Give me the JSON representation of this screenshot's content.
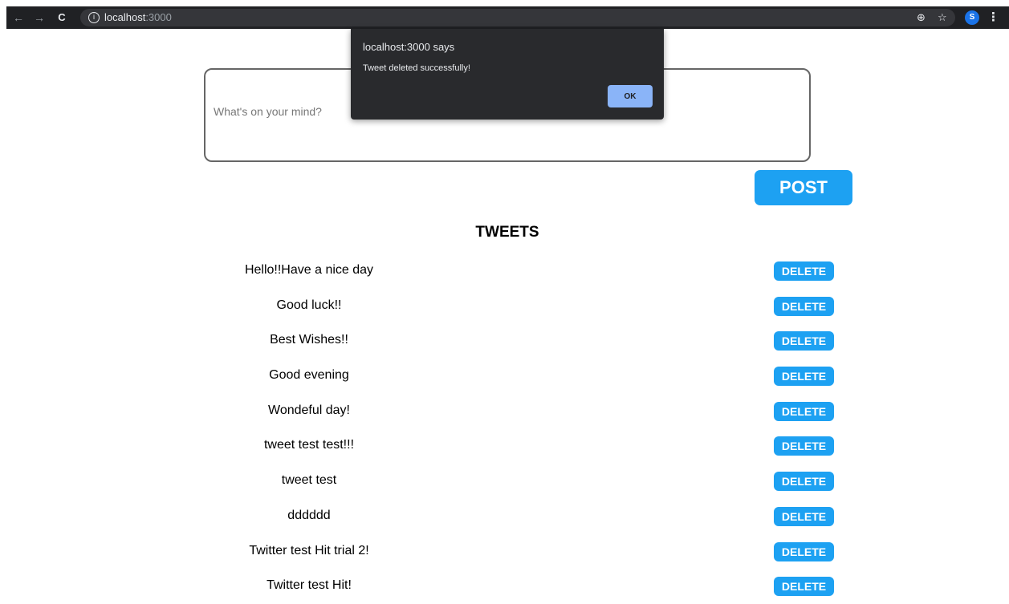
{
  "browser": {
    "url_host": "localhost",
    "url_port": ":3000",
    "avatar_initial": "S",
    "icons": {
      "back": "arrow-left-icon",
      "forward": "arrow-right-icon",
      "reload": "reload-icon",
      "info": "info-icon",
      "zoom": "zoom-icon",
      "bookmark": "star-icon",
      "menu": "kebab-menu-icon"
    }
  },
  "composer": {
    "placeholder": "What's on your mind?",
    "value": "",
    "post_label": "POST"
  },
  "tweets": {
    "heading": "TWEETS",
    "delete_label": "DELETE",
    "items": [
      "Hello!!Have a nice day",
      "Good luck!!",
      "Best Wishes!!",
      "Good evening",
      "Wondeful day!",
      "tweet test test!!!",
      "tweet test",
      "dddddd",
      "Twitter test Hit trial 2!",
      "Twitter test Hit!"
    ]
  },
  "alert": {
    "title": "localhost:3000 says",
    "message": "Tweet deleted successfully!",
    "ok_label": "OK"
  },
  "colors": {
    "accent": "#1da1f2",
    "chrome_bg": "#202124",
    "dialog_bg": "#292a2d",
    "dialog_button": "#8ab4f8"
  }
}
